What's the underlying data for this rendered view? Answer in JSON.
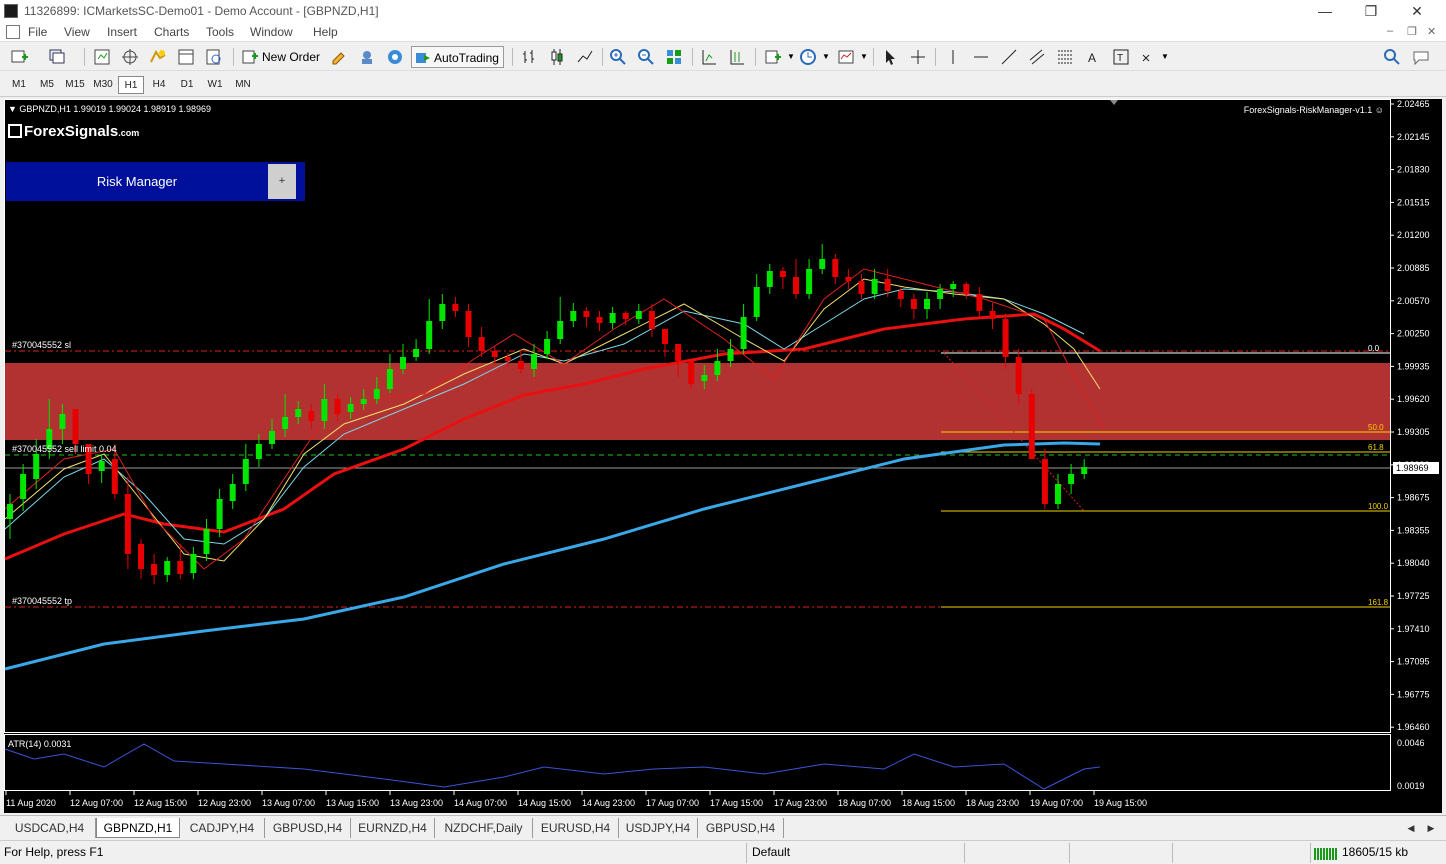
{
  "window": {
    "title": "11326899: ICMarketsSC-Demo01 - Demo Account - [GBPNZD,H1]"
  },
  "menu": [
    "File",
    "View",
    "Insert",
    "Charts",
    "Tools",
    "Window",
    "Help"
  ],
  "toolbar": {
    "new_order": "New Order",
    "autotrading": "AutoTrading"
  },
  "timeframes": [
    "M1",
    "M5",
    "M15",
    "M30",
    "H1",
    "H4",
    "D1",
    "W1",
    "MN"
  ],
  "active_timeframe": "H1",
  "chart": {
    "info": "GBPNZD,H1  1.99019 1.99024 1.98919 1.98969",
    "logo": "ForexSignals",
    "logo_suffix": ".com",
    "risk_manager_label": "Risk Manager",
    "risk_manager_plus": "+",
    "ea_label": "ForexSignals-RiskManager-v1.1",
    "current_price": "1.98969",
    "sl_label": "#370045552 sl",
    "entry_label": "#370045552 sell limit 0.04",
    "tp_label": "#370045552 tp",
    "atr_label": "ATR(14) 0.0031",
    "atr_scale": [
      "0.0046",
      "0.0019"
    ],
    "price_scale": [
      "2.02465",
      "2.02145",
      "2.01830",
      "2.01515",
      "2.01200",
      "2.00885",
      "2.00570",
      "2.00250",
      "1.99935",
      "1.99620",
      "1.99305",
      "1.98990",
      "1.98675",
      "1.98355",
      "1.98040",
      "1.97725",
      "1.97410",
      "1.97095",
      "1.96775",
      "1.96460"
    ],
    "fib_levels": [
      "0.0",
      "50.0",
      "61.8",
      "100.0",
      "161.8"
    ],
    "time_labels": [
      "11 Aug 2020",
      "12 Aug 07:00",
      "12 Aug 15:00",
      "12 Aug 23:00",
      "13 Aug 07:00",
      "13 Aug 15:00",
      "13 Aug 23:00",
      "14 Aug 07:00",
      "14 Aug 15:00",
      "14 Aug 23:00",
      "17 Aug 07:00",
      "17 Aug 15:00",
      "17 Aug 23:00",
      "18 Aug 07:00",
      "18 Aug 15:00",
      "18 Aug 23:00",
      "19 Aug 07:00",
      "19 Aug 15:00"
    ]
  },
  "tabs": [
    "USDCAD,H4",
    "GBPNZD,H1",
    "CADJPY,H4",
    "GBPUSD,H4",
    "EURNZD,H4",
    "NZDCHF,Daily",
    "EURUSD,H4",
    "USDJPY,H4",
    "GBPUSD,H4"
  ],
  "active_tab": "GBPNZD,H1",
  "status": {
    "help": "For Help, press F1",
    "profile": "Default",
    "traffic": "18605/15 kb"
  },
  "colors": {
    "bull": "#00e600",
    "bear": "#e60000",
    "zone": "#b23232",
    "ma_blue": "#3aa8e8",
    "ma_red": "#e81010",
    "panel": "#00109a"
  }
}
